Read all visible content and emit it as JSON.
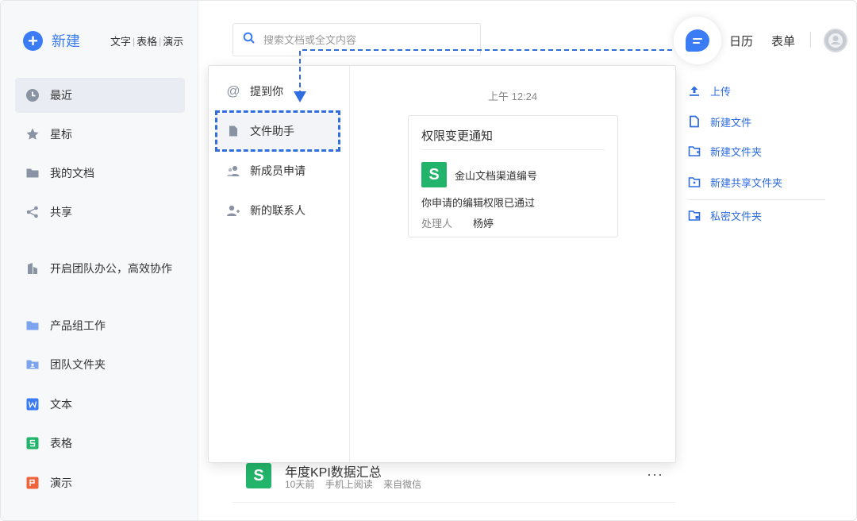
{
  "sidebar": {
    "new_label": "新建",
    "quick_types": [
      "文字",
      "表格",
      "演示"
    ],
    "items": [
      {
        "label": "最近",
        "icon": "clock-icon"
      },
      {
        "label": "星标",
        "icon": "star-icon"
      },
      {
        "label": "我的文档",
        "icon": "folder-icon"
      },
      {
        "label": "共享",
        "icon": "share-icon"
      },
      {
        "label": "开启团队办公，高效协作",
        "icon": "building-icon"
      },
      {
        "label": "产品组工作",
        "icon": "folder-icon"
      },
      {
        "label": "团队文件夹",
        "icon": "team-folder-icon"
      },
      {
        "label": "文本",
        "icon": "doc-w-icon"
      },
      {
        "label": "表格",
        "icon": "sheet-s-icon"
      },
      {
        "label": "演示",
        "icon": "slide-p-icon"
      }
    ]
  },
  "search": {
    "placeholder": "搜索文档或全文内容"
  },
  "header": {
    "calendar": "日历",
    "form": "表单"
  },
  "actions": [
    {
      "label": "上传",
      "icon": "upload-icon"
    },
    {
      "label": "新建文件",
      "icon": "new-file-icon"
    },
    {
      "label": "新建文件夹",
      "icon": "new-folder-icon"
    },
    {
      "label": "新建共享文件夹",
      "icon": "new-shared-folder-icon"
    },
    {
      "label": "私密文件夹",
      "icon": "private-folder-icon"
    }
  ],
  "file_row": {
    "icon_letter": "S",
    "name": "年度KPI数据汇总",
    "meta": [
      "10天前",
      "手机上阅读",
      "来自微信"
    ],
    "more": "···"
  },
  "popup": {
    "items": [
      {
        "label": "提到你",
        "icon": "at-icon"
      },
      {
        "label": "文件助手",
        "icon": "file-icon"
      },
      {
        "label": "新成员申请",
        "icon": "members-icon"
      },
      {
        "label": "新的联系人",
        "icon": "add-contact-icon"
      }
    ],
    "time": "上午 12:24",
    "card": {
      "title": "权限变更通知",
      "icon_letter": "S",
      "sender": "金山文档渠道编号",
      "message": "你申请的编辑权限已通过",
      "handler_label": "处理人",
      "handler_name": "杨婷"
    }
  },
  "colors": {
    "accent": "#3b7cf5",
    "link": "#2f6de1",
    "sheet_green": "#22b46a",
    "slide_orange": "#f0643c"
  }
}
